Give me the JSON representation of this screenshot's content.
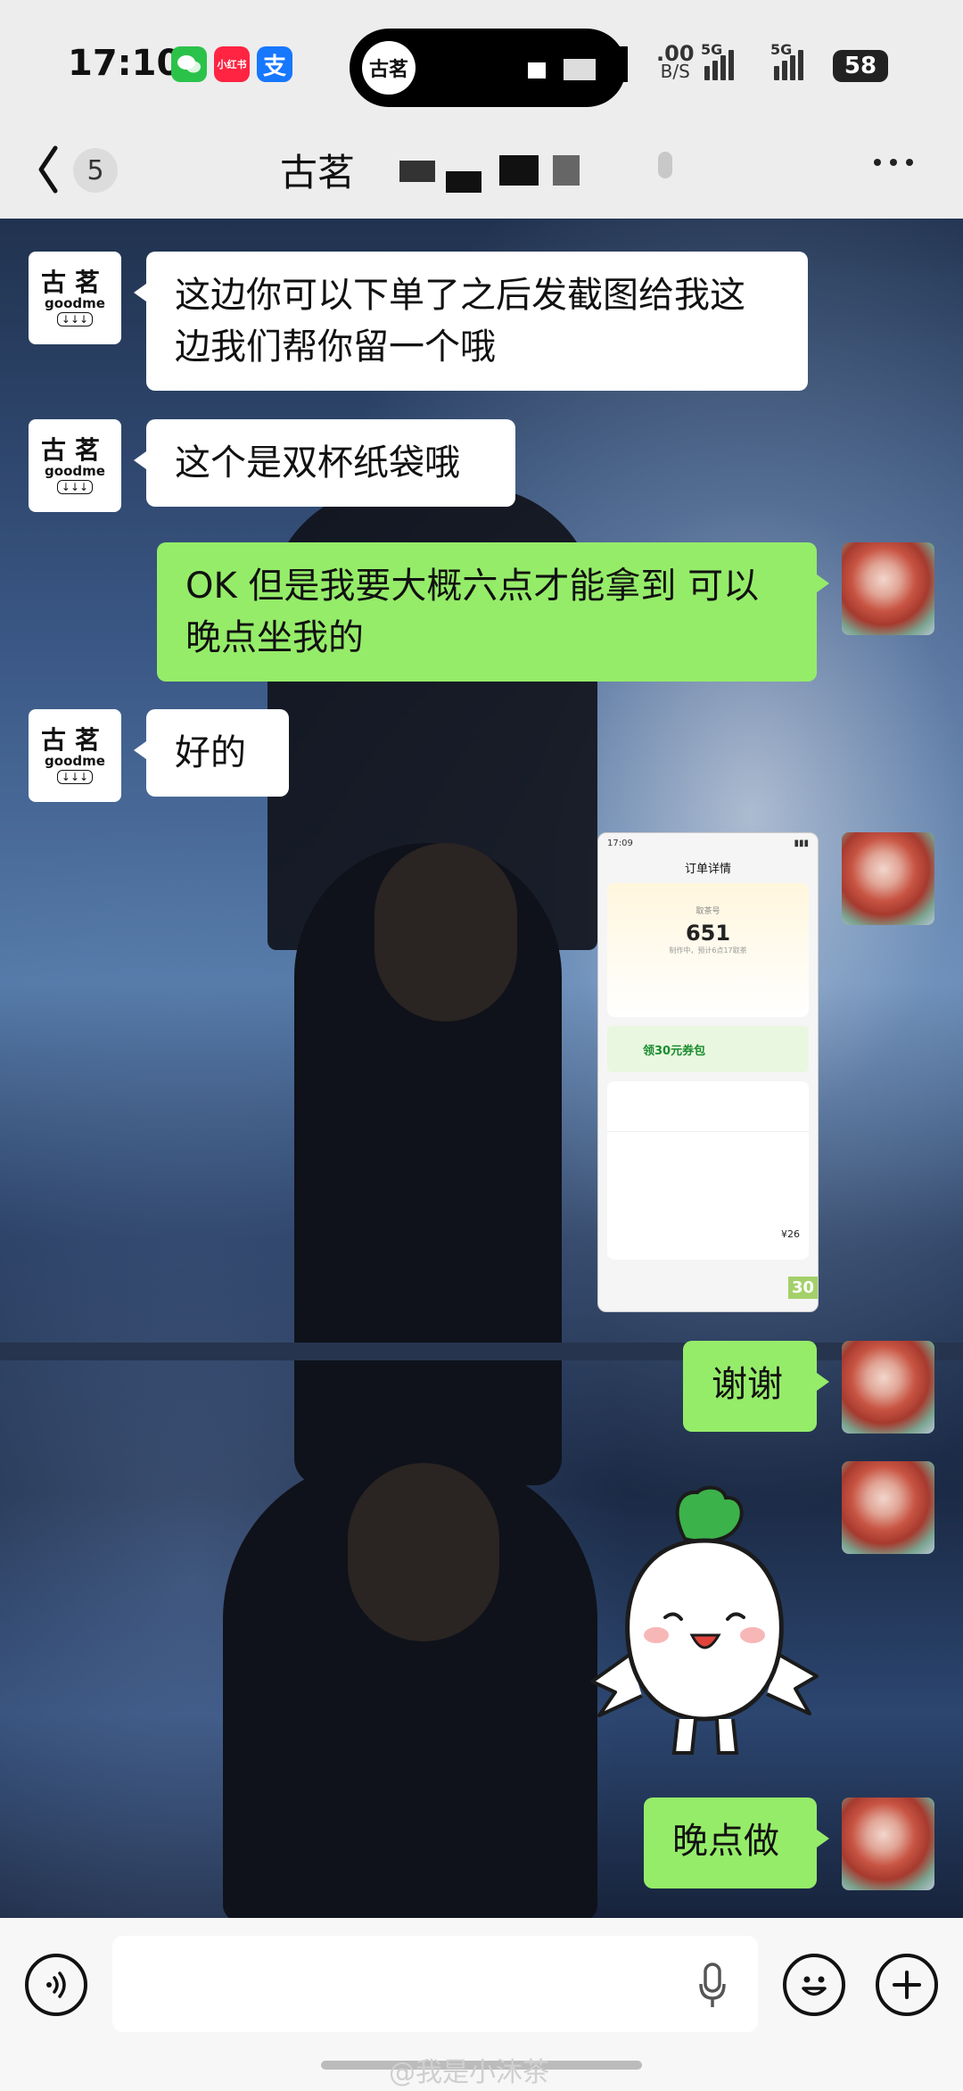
{
  "status_bar": {
    "time": "17:10",
    "app_icons": [
      {
        "name": "wechat-icon",
        "label": "",
        "color": "#2bc24a"
      },
      {
        "name": "xiaohongshu-icon",
        "label": "小红书",
        "color": "#ff2442"
      },
      {
        "name": "alipay-icon",
        "label": "支",
        "color": "#1677ff"
      }
    ],
    "notification_logo": "古茗",
    "net_speed_value": ".00",
    "net_speed_unit": "B/S",
    "signal_label_1": "5G",
    "signal_label_2": "5G",
    "battery": "58"
  },
  "nav": {
    "unread_count": "5",
    "title": "古茗"
  },
  "contact_avatar": {
    "line1": "古茗",
    "line2": "goodme",
    "line3": "↓↓↓"
  },
  "messages": [
    {
      "side": "left",
      "text": "这边你可以下单了之后发截图给我这边我们帮你留一个哦"
    },
    {
      "side": "left",
      "text": "这个是双杯纸袋哦"
    },
    {
      "side": "right",
      "text": "OK 但是我要大概六点才能拿到 可以晚点坐我的"
    },
    {
      "side": "left",
      "text": "好的"
    },
    {
      "side": "right",
      "type": "image"
    },
    {
      "side": "right",
      "text": "谢谢"
    },
    {
      "side": "right",
      "type": "sticker"
    },
    {
      "side": "right",
      "text": "晚点做"
    }
  ],
  "shared_screenshot": {
    "time": "17:09",
    "header": "订单详情",
    "pickup_label": "取茶号",
    "pickup_number": "651",
    "status": "制作中，预计6点17取茶",
    "coupon": "领30元券包",
    "price": "¥26",
    "corner_mark": "30"
  },
  "watermark": "@我是小沐茶"
}
